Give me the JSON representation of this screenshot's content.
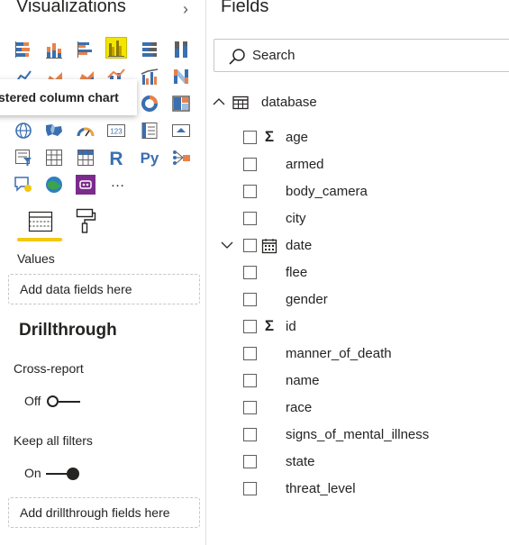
{
  "visualizations": {
    "title": "Visualizations",
    "tooltip": "stered column chart",
    "icons": [
      "stacked-bar-chart-icon",
      "stacked-column-chart-icon",
      "clustered-bar-chart-icon",
      "clustered-column-chart-icon",
      "100-stacked-bar-chart-icon",
      "100-stacked-column-chart-icon",
      "line-chart-icon",
      "area-chart-icon",
      "stacked-area-chart-icon",
      "line-and-stacked-column-icon",
      "line-and-clustered-column-icon",
      "ribbon-chart-icon",
      "waterfall-chart-icon",
      "funnel-chart-icon",
      "scatter-chart-icon",
      "pie-chart-icon",
      "donut-chart-icon",
      "treemap-icon",
      "globe-map-icon",
      "filled-map-icon",
      "gauge-icon",
      "card-icon",
      "multi-row-card-icon",
      "kpi-icon",
      "slicer-icon",
      "table-icon",
      "matrix-icon",
      "r-visual-icon",
      "python-visual-icon",
      "key-influencers-icon",
      "qa-icon",
      "arcgis-map-icon",
      "custom-visual-icon",
      "more-visuals-icon"
    ],
    "tabs": {
      "fields": "fields-tab",
      "format": "format-tab"
    },
    "values_label": "Values",
    "values_well": "Add data fields here",
    "drillthrough": {
      "heading": "Drillthrough",
      "cross_report_label": "Cross-report",
      "cross_report_state": "Off",
      "keep_filters_label": "Keep all filters",
      "keep_filters_state": "On",
      "well": "Add drillthrough fields here"
    }
  },
  "fields": {
    "title": "Fields",
    "search_placeholder": "Search",
    "table": "database",
    "items": [
      {
        "name": "age",
        "type": "sigma"
      },
      {
        "name": "armed",
        "type": ""
      },
      {
        "name": "body_camera",
        "type": ""
      },
      {
        "name": "city",
        "type": ""
      },
      {
        "name": "date",
        "type": "calendar",
        "expandable": true
      },
      {
        "name": "flee",
        "type": ""
      },
      {
        "name": "gender",
        "type": ""
      },
      {
        "name": "id",
        "type": "sigma"
      },
      {
        "name": "manner_of_death",
        "type": ""
      },
      {
        "name": "name",
        "type": ""
      },
      {
        "name": "race",
        "type": ""
      },
      {
        "name": "signs_of_mental_illness",
        "type": ""
      },
      {
        "name": "state",
        "type": ""
      },
      {
        "name": "threat_level",
        "type": ""
      }
    ]
  },
  "colors": {
    "accent_yellow": "#f2c811",
    "selected_icon_bg": "#f2e600",
    "chart_orange": "#e8824b",
    "chart_blue": "#3a6fb0",
    "text": "#252423"
  }
}
